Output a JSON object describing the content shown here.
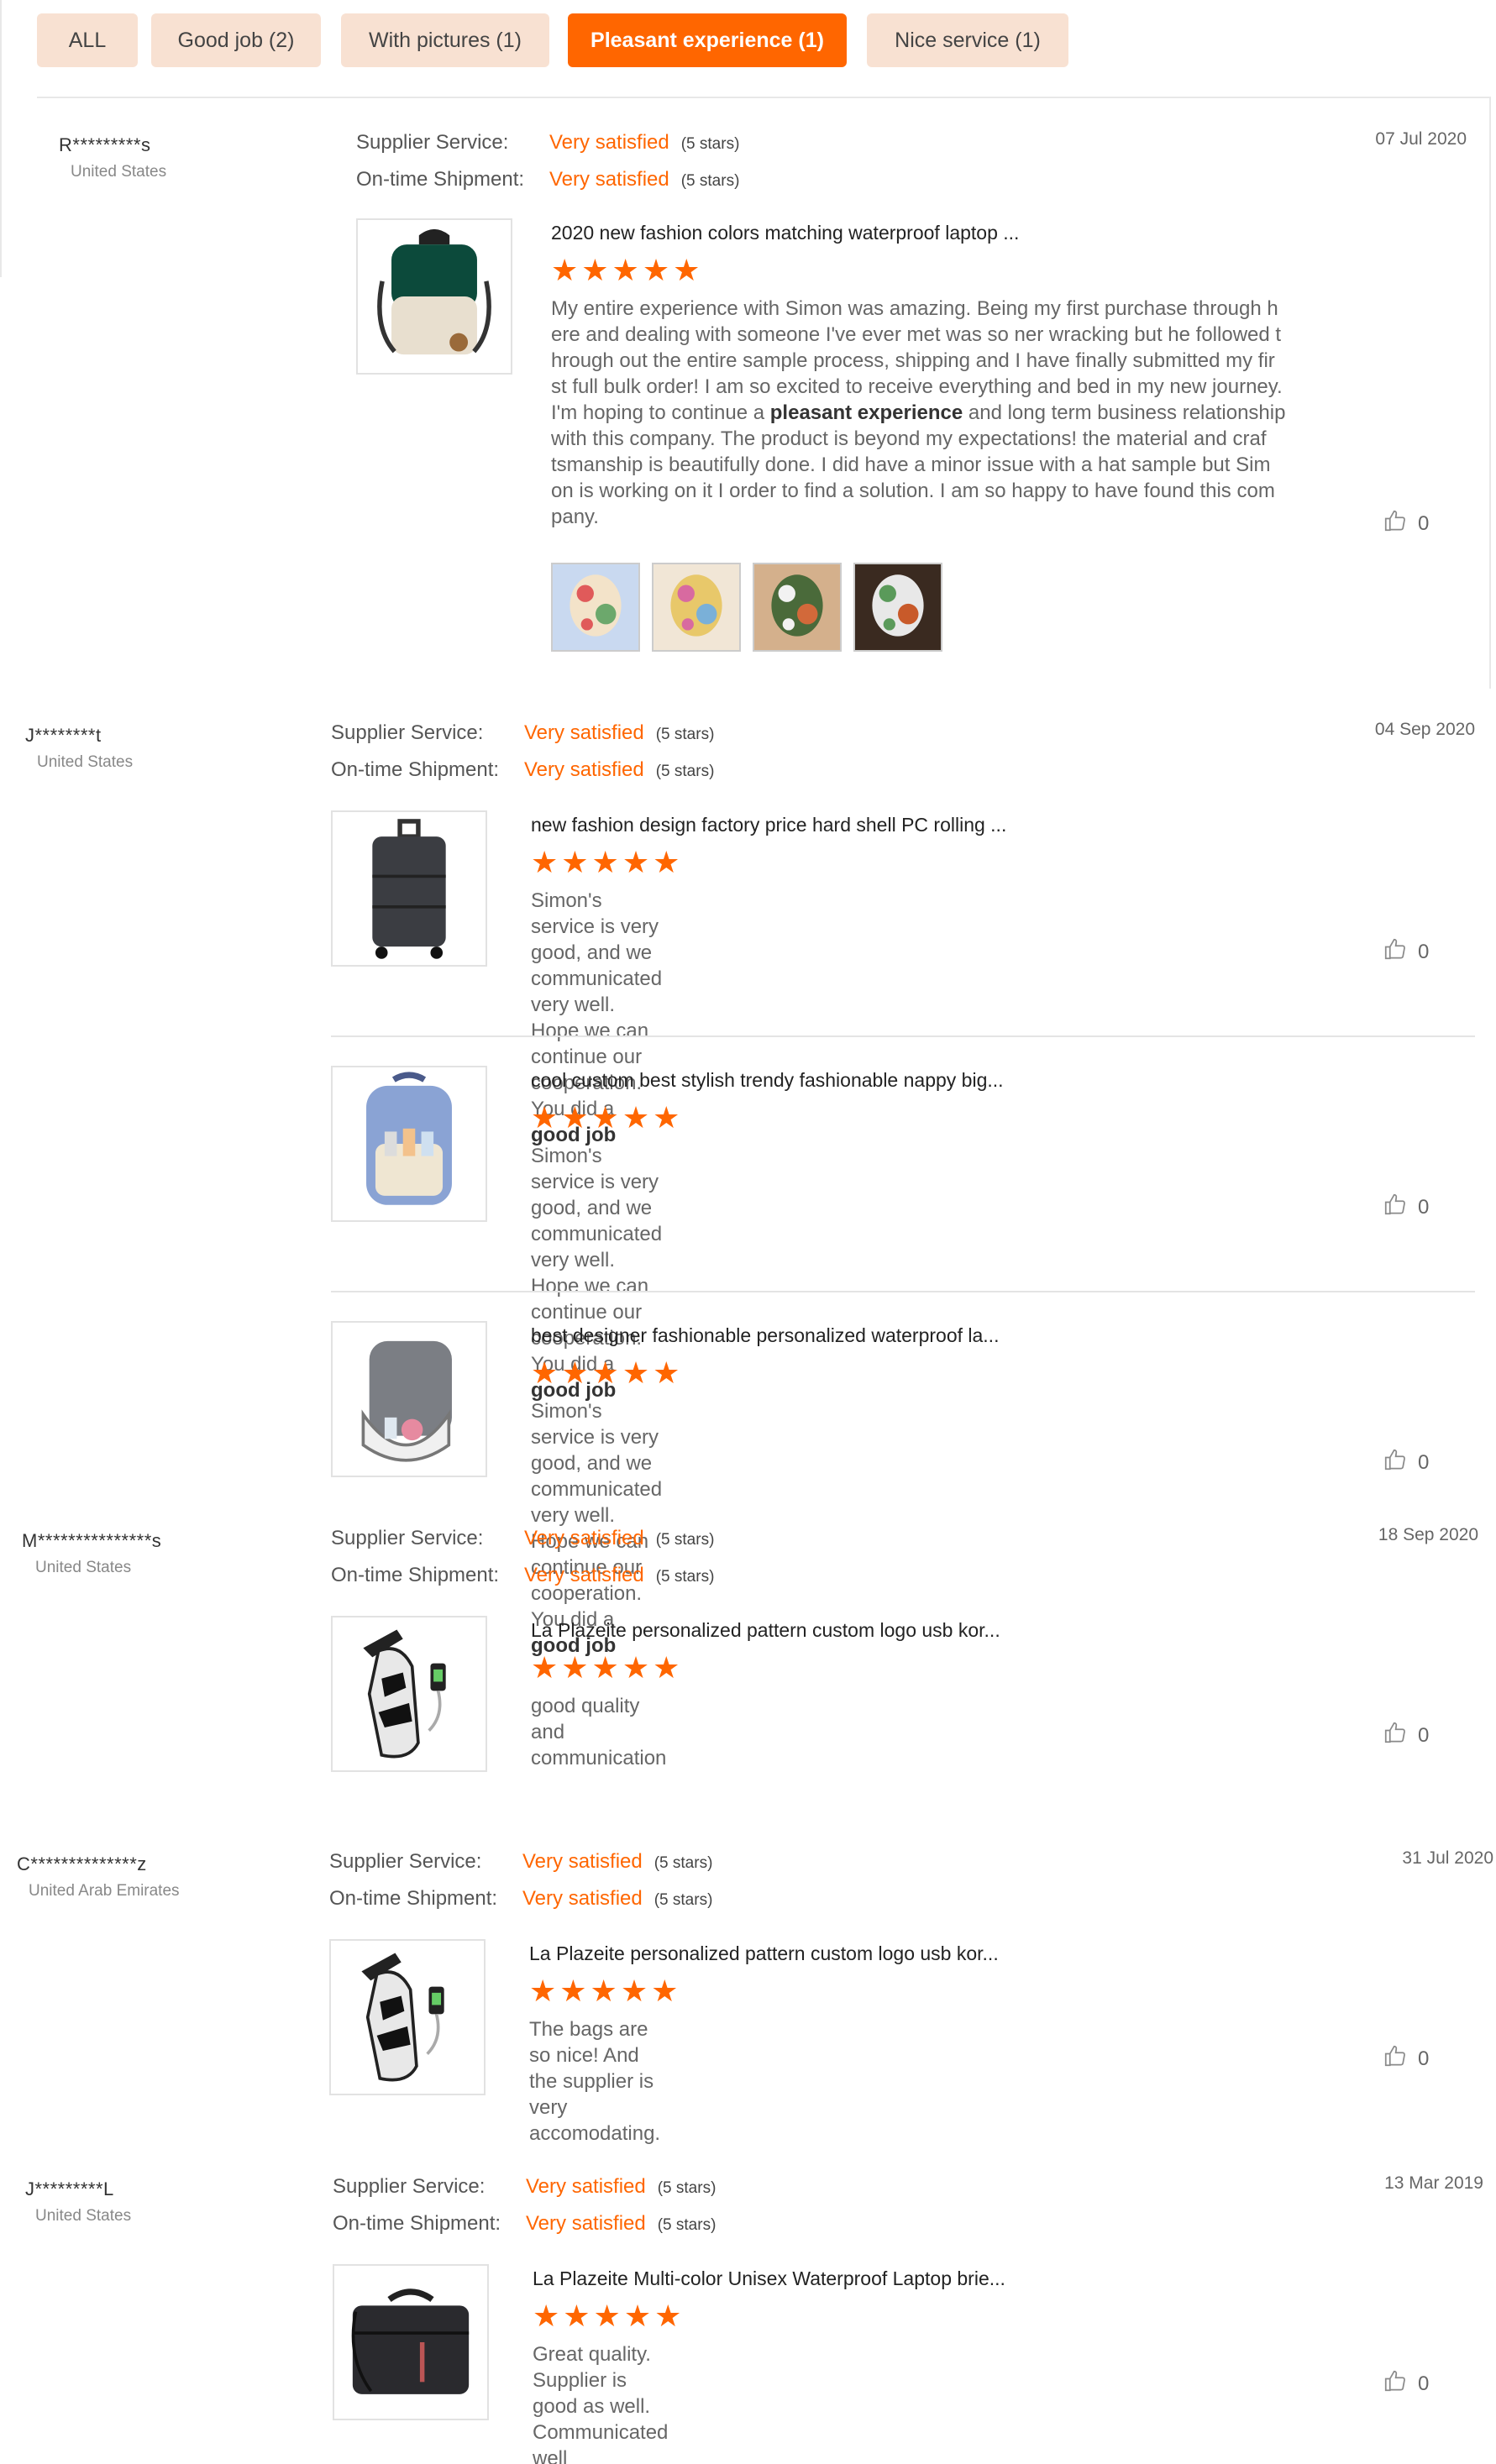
{
  "filters": [
    {
      "label": "ALL"
    },
    {
      "label": "Good job (2)"
    },
    {
      "label": "With pictures (1)"
    },
    {
      "label": "Pleasant experience (1)"
    },
    {
      "label": "Nice service (1)"
    }
  ],
  "rating_labels": {
    "supplier": "Supplier Service:",
    "shipment": "On-time Shipment:"
  },
  "colors": {
    "accent": "#ff6600",
    "tab_bg": "#f8e1d2"
  },
  "stars_glyph": "★★★★★",
  "reviews": [
    {
      "name": "R*********s",
      "country": "United States",
      "date": "07 Jul 2020",
      "supplier": {
        "value": "Very satisfied",
        "stars": "(5 stars)"
      },
      "shipment": {
        "value": "Very satisfied",
        "stars": "(5 stars)"
      },
      "products": [
        {
          "image": "backpack-green-cream",
          "title": "2020 new fashion colors matching waterproof laptop ...",
          "rating": 5,
          "comment_parts": [
            "My entire experience with Simon was amazing.  Being my first purchase through h\nere and dealing with someone I've ever met was so ner wracking but he followed t\nhrough out the entire sample process, shipping and I have finally submitted my fir\nst full bulk order! I am so excited to receive everything and bed in my new journey.\nI'm hoping to continue a ",
            "pleasant experience",
            " and long term business relationship\nwith this company.  The product is beyond my expectations!  the material and craf\ntsmanship is beautifully done. I did have a minor issue with a hat sample but Sim\non is working on it I order to find a solution. I am so happy to have found this com\npany."
          ],
          "likes": "0",
          "pictures": [
            "photo-1",
            "photo-2",
            "photo-3",
            "photo-4"
          ]
        }
      ]
    },
    {
      "name": "J********t",
      "country": "United States",
      "date": "04 Sep 2020",
      "supplier": {
        "value": "Very satisfied",
        "stars": "(5 stars)"
      },
      "shipment": {
        "value": "Very satisfied",
        "stars": "(5 stars)"
      },
      "products": [
        {
          "image": "suitcase-black",
          "title": "new fashion design factory price hard shell PC rolling ...",
          "rating": 5,
          "comment_parts": [
            "Simon's service is very good, and we communicated very well.\nHope we can continue our cooperation.\nYou did a ",
            "good job",
            ""
          ],
          "likes": "0"
        },
        {
          "image": "diaper-backpack-blue",
          "title": "cool custom best stylish trendy fashionable nappy big...",
          "rating": 5,
          "comment_parts": [
            "Simon's service is very good, and we communicated very well.\nHope we can continue our cooperation.\nYou did a ",
            "good job",
            ""
          ],
          "likes": "0"
        },
        {
          "image": "diaper-backpack-grey",
          "title": "best designer fashionable personalized waterproof la...",
          "rating": 5,
          "comment_parts": [
            "Simon's service is very good, and we communicated very well.\nHope we can continue our cooperation.\nYou did a ",
            "good job",
            ""
          ],
          "likes": "0"
        }
      ]
    },
    {
      "name": "M***************s",
      "country": "United States",
      "date": "18 Sep 2020",
      "supplier": {
        "value": "Very satisfied",
        "stars": "(5 stars)"
      },
      "shipment": {
        "value": "Very satisfied",
        "stars": "(5 stars)"
      },
      "products": [
        {
          "image": "sling-bag-camo",
          "title": "La Plazeite personalized pattern custom logo usb kor...",
          "rating": 5,
          "comment_parts": [
            "good quality and communication",
            "",
            ""
          ],
          "likes": "0"
        }
      ]
    },
    {
      "name": "C**************z",
      "country": "United Arab Emirates",
      "date": "31 Jul 2020",
      "supplier": {
        "value": "Very satisfied",
        "stars": "(5 stars)"
      },
      "shipment": {
        "value": "Very satisfied",
        "stars": "(5 stars)"
      },
      "products": [
        {
          "image": "sling-bag-camo",
          "title": "La Plazeite personalized pattern custom logo usb kor...",
          "rating": 5,
          "comment_parts": [
            "The bags are so nice! And the supplier is very accomodating.",
            "",
            ""
          ],
          "likes": "0"
        }
      ]
    },
    {
      "name": "J*********L",
      "country": "United States",
      "date": "13 Mar 2019",
      "supplier": {
        "value": "Very satisfied",
        "stars": "(5 stars)"
      },
      "shipment": {
        "value": "Very satisfied",
        "stars": "(5 stars)"
      },
      "products": [
        {
          "image": "laptop-briefcase-black",
          "title": "La Plazeite Multi-color Unisex Waterproof Laptop brie...",
          "rating": 5,
          "comment_parts": [
            "Great quality. Supplier is good as well. Communicated well",
            "",
            ""
          ],
          "likes": "0"
        }
      ]
    }
  ]
}
